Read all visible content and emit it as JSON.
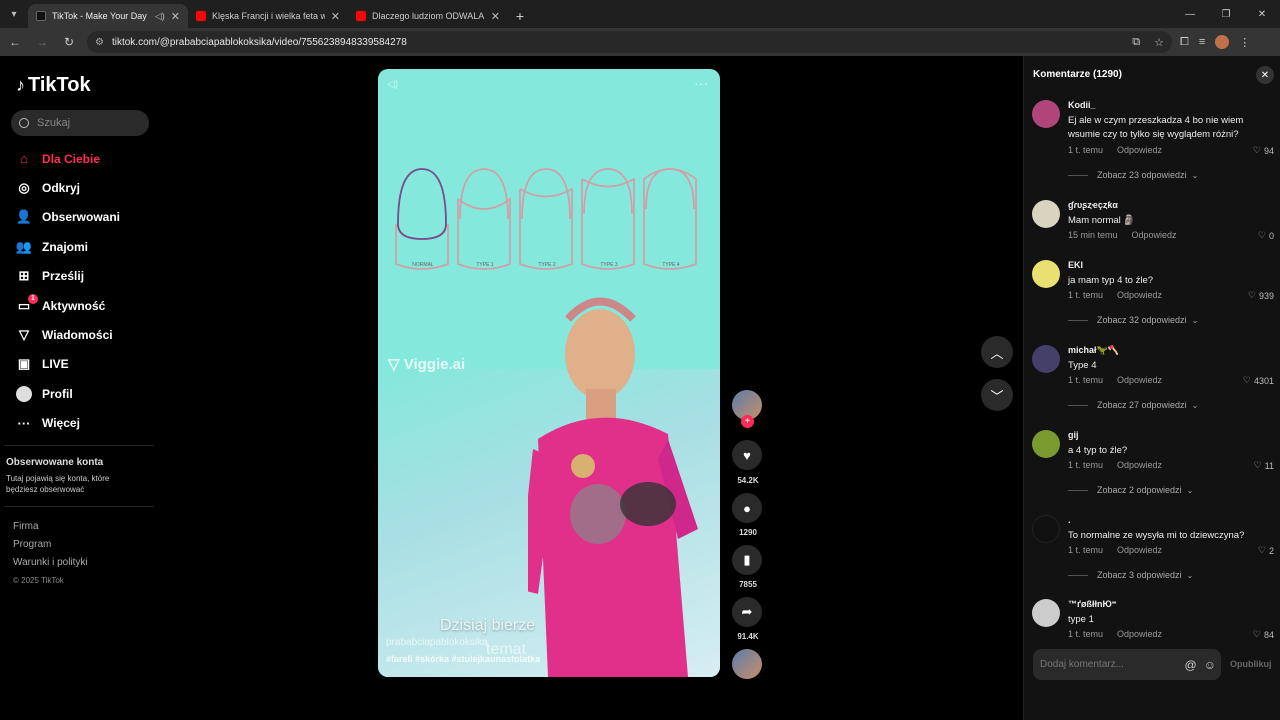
{
  "browser": {
    "tabs": [
      {
        "title": "TikTok - Make Your Day",
        "favicon": "tiktok-favicon",
        "active": true
      },
      {
        "title": "Klęska Francji i wielka feta w Ne",
        "favicon": "youtube-favicon",
        "active": false
      },
      {
        "title": "Dlaczego ludziom ODWALA od",
        "favicon": "youtube-favicon",
        "active": false
      }
    ],
    "url": "tiktok.com/@prababciapablokoksika/video/7556238948339584278"
  },
  "sidebar": {
    "logo": "TikTok",
    "search_placeholder": "Szukaj",
    "items": [
      {
        "label": "Dla Ciebie",
        "icon": "home-icon"
      },
      {
        "label": "Odkryj",
        "icon": "compass-icon"
      },
      {
        "label": "Obserwowani",
        "icon": "user-follow-icon"
      },
      {
        "label": "Znajomi",
        "icon": "friends-icon"
      },
      {
        "label": "Prześlij",
        "icon": "upload-icon"
      },
      {
        "label": "Aktywność",
        "icon": "activity-icon",
        "badge": "1"
      },
      {
        "label": "Wiadomości",
        "icon": "send-icon"
      },
      {
        "label": "LIVE",
        "icon": "live-icon"
      },
      {
        "label": "Profil",
        "icon": "avatar-icon"
      },
      {
        "label": "Więcej",
        "icon": "more-icon"
      }
    ],
    "followed_title": "Obserwowane konta",
    "followed_desc": "Tutaj pojawią się konta, które będziesz obserwować",
    "footer": {
      "links": [
        "Firma",
        "Program",
        "Warunki i polityki"
      ],
      "copyright": "© 2025 TikTok"
    }
  },
  "video": {
    "shape_labels": [
      "NORMAL",
      "TYPE 1",
      "TYPE 2",
      "TYPE 3",
      "TYPE 4"
    ],
    "watermark": "Viggie.ai",
    "caption_line1": "Dzisiaj bierze",
    "caption_line2": "temat",
    "author": "prababciapablokoksika",
    "tags": "#fareli  #skórka  #stulejkaunastolatka"
  },
  "actions": {
    "likes": "54.2K",
    "comments": "1290",
    "saves": "7855",
    "shares": "91.4K"
  },
  "comments_panel": {
    "title": "Komentarze (1290)",
    "input_placeholder": "Dodaj komentarz...",
    "publish_label": "Opublikuj",
    "reply_label": "Odpowiedz",
    "comments": [
      {
        "user": "Kodii_",
        "text": "Ej ale w czym przeszkadza 4 bo nie wiem wsumie czy to tylko się wyglądem różni?",
        "time": "1 t. temu",
        "likes": "94",
        "replies": "Zobacz 23 odpowiedzi",
        "avatar_color": "#b0457a"
      },
      {
        "user": "ɠɾυʂȥҽçȥƙα",
        "text": "Mam normal 🗿",
        "time": "15 min temu",
        "likes": "0",
        "replies": "",
        "avatar_color": "#d8d4c0"
      },
      {
        "user": "EKI",
        "text": "ja mam typ 4 to źle?",
        "time": "1 t. temu",
        "likes": "939",
        "replies": "Zobacz 32 odpowiedzi",
        "avatar_color": "#e8e070"
      },
      {
        "user": "michał🦖🪓",
        "text": "Type 4",
        "time": "1 t. temu",
        "likes": "4301",
        "replies": "Zobacz 27 odpowiedzi",
        "avatar_color": "#44406a"
      },
      {
        "user": "gij",
        "text": "a 4 typ to źle?",
        "time": "1 t. temu",
        "likes": "11",
        "replies": "Zobacz 2 odpowiedzi",
        "avatar_color": "#7a9a30"
      },
      {
        "user": ".",
        "text": "To normalne ze wysyła mi to dziewczyna?",
        "time": "1 t. temu",
        "likes": "2",
        "replies": "Zobacz 3 odpowiedzi",
        "avatar_color": "#111111"
      },
      {
        "user": "™ґøßłłnЮ⁼",
        "text": "type 1",
        "time": "1 t. temu",
        "likes": "84",
        "replies": "",
        "avatar_color": "#cccccc"
      }
    ]
  }
}
